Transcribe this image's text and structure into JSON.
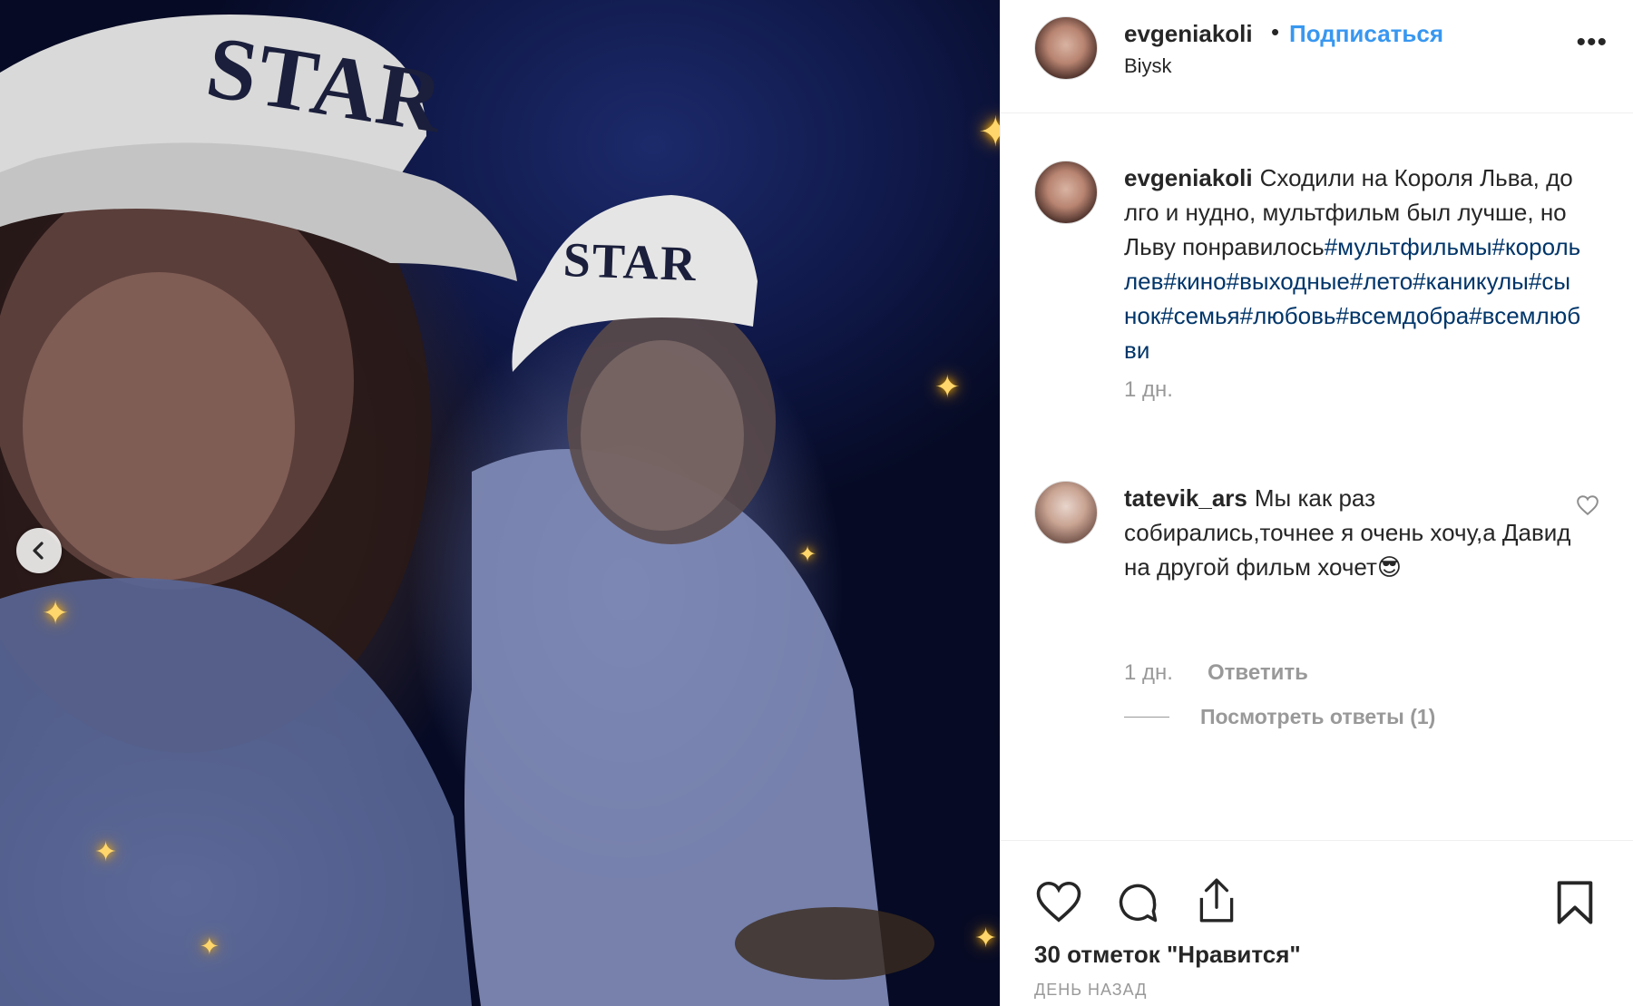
{
  "post": {
    "username": "evgeniakoli",
    "follow_label": "Подписаться",
    "location": "Biysk",
    "more_label": "•••"
  },
  "photo": {
    "cap_text_large": "STAR",
    "cap_text_small": "STAR"
  },
  "caption": {
    "username": "evgeniakoli",
    "text": "Сходили на Короля Льва, долго и нудно, мультфильм был лучше, но Льву понравилось",
    "hashtags": "#мультфильмы#корольлев#кино#выходные#лето#каникулы#сынок#семья#любовь#всемдобра#всемлюбви",
    "time": "1 дн."
  },
  "comment": {
    "username": "tatevik_ars",
    "text": "Мы как раз собирались,точнее я очень хочу,а Давид на другой фильм хочет😎",
    "time": "1 дн.",
    "reply_label": "Ответить",
    "view_replies_label": "Посмотреть ответы (1)"
  },
  "footer": {
    "likes_text": "30 отметок \"Нравится\"",
    "date_text": "ДЕНЬ НАЗАД"
  },
  "icons": {
    "prev": "chevron-left-icon",
    "like": "heart-icon",
    "comment": "comment-bubble-icon",
    "share": "share-icon",
    "save": "bookmark-icon"
  },
  "colors": {
    "follow": "#3897f0",
    "hashtag": "#003569",
    "muted": "#999999",
    "text": "#262626"
  }
}
